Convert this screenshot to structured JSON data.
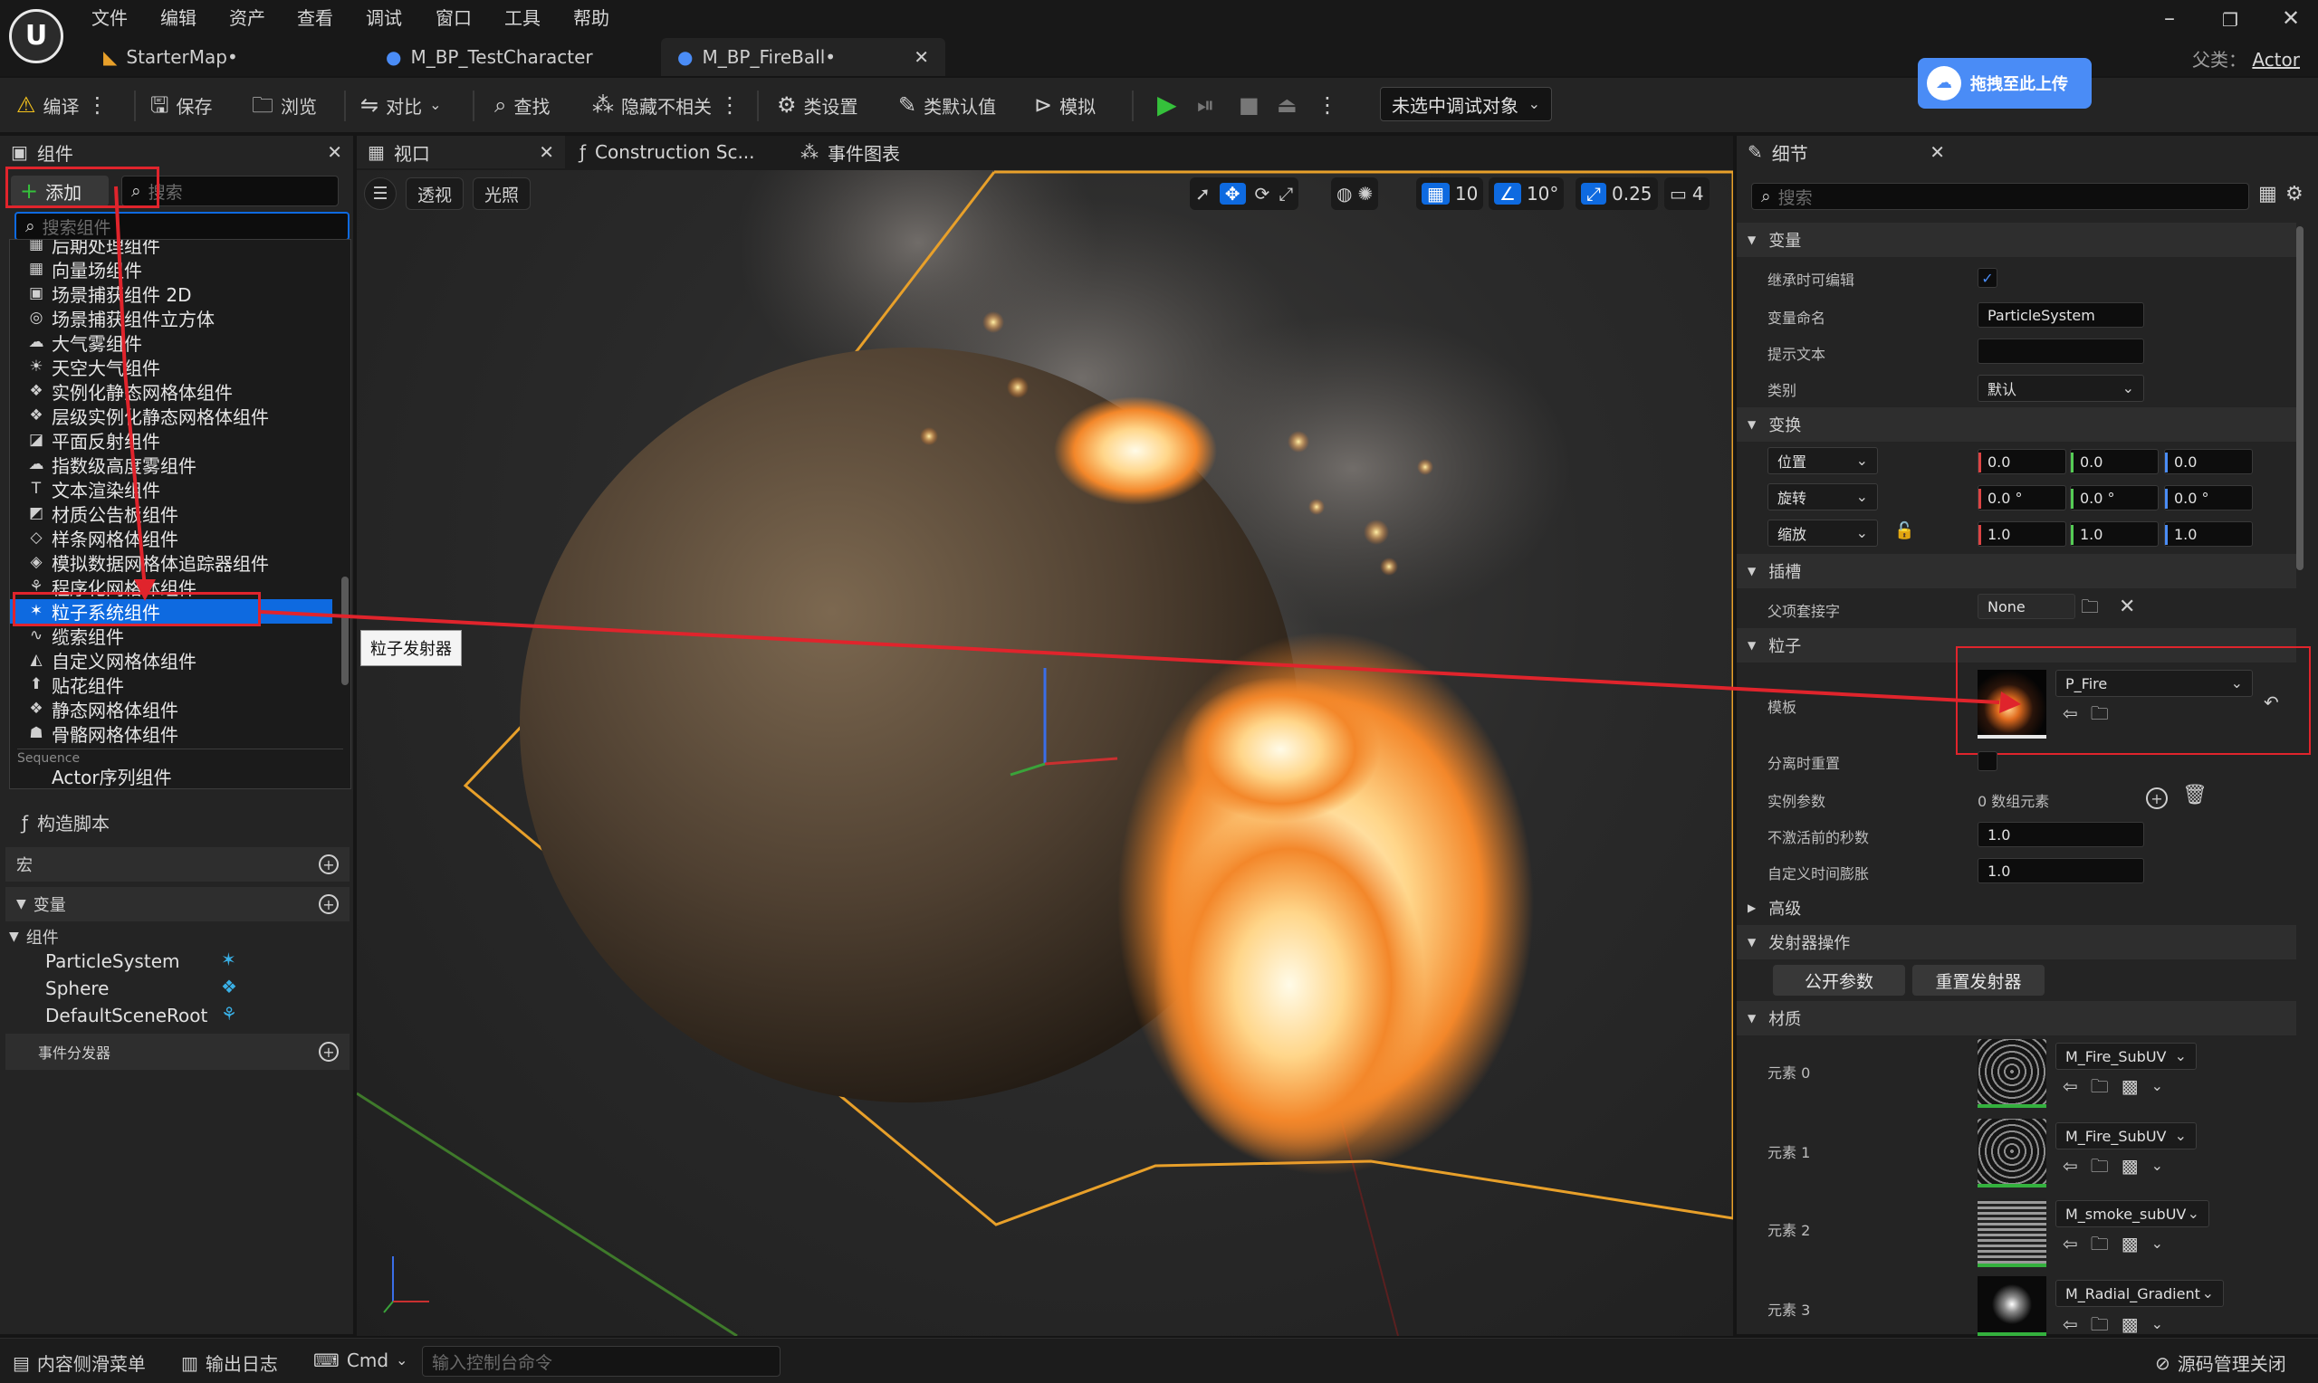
{
  "menu": [
    "文件",
    "编辑",
    "资产",
    "查看",
    "调试",
    "窗口",
    "工具",
    "帮助"
  ],
  "tabs": [
    "StarterMap•",
    "M_BP_TestCharacter",
    "M_BP_FireBall•"
  ],
  "parent": {
    "label": "父类：",
    "value": "Actor"
  },
  "toolbar": {
    "compile": "编译",
    "save": "保存",
    "browse": "浏览",
    "diff": "对比",
    "find": "查找",
    "hide_unrelated": "隐藏不相关",
    "class_settings": "类设置",
    "class_defaults": "类默认值",
    "simulate": "模拟",
    "debug_target": "未选中调试对象"
  },
  "upload": "拖拽至此上传",
  "components_panel": {
    "title": "组件",
    "add": "添加",
    "search_placeholder": "搜索",
    "dropdown_placeholder": "搜索组件",
    "items": [
      "后期处理组件",
      "向量场组件",
      "场景捕获组件 2D",
      "场景捕获组件立方体",
      "大气雾组件",
      "天空大气组件",
      "实例化静态网格体组件",
      "层级实例化静态网格体组件",
      "平面反射组件",
      "指数级高度雾组件",
      "文本渲染组件",
      "材质公告板组件",
      "样条网格体组件",
      "模拟数据网格体追踪器组件",
      "程序化网格体组件",
      "粒子系统组件",
      "缆索组件",
      "自定义网格体组件",
      "贴花组件",
      "静态网格体组件",
      "骨骼网格体组件"
    ],
    "selected_item": "粒子系统组件",
    "sequence_header": "Sequence",
    "sequence_item": "Actor序列组件",
    "construct": "构造脚本",
    "macros": "宏",
    "variables": "变量",
    "components": "组件",
    "tree": [
      "ParticleSystem",
      "Sphere",
      "DefaultSceneRoot"
    ],
    "dispatchers": "事件分发器"
  },
  "center_tabs": [
    "视口",
    "Construction Sc...",
    "事件图表"
  ],
  "viewport": {
    "perspective": "透视",
    "lit": "光照",
    "grid": "10",
    "angle": "10°",
    "scale": "0.25",
    "camera": "4"
  },
  "tooltip": "粒子发射器",
  "details": {
    "title": "细节",
    "search_placeholder": "搜索",
    "sections": {
      "variable": "变量",
      "transform": "变换",
      "sockets": "插槽",
      "particles": "粒子",
      "advanced": "高级",
      "emitter_actions": "发射器操作",
      "materials": "材质"
    },
    "rows": {
      "editable": "继承时可编辑",
      "var_name": "变量命名",
      "tooltip": "提示文本",
      "category": "类别",
      "location": "位置",
      "rotation": "旋转",
      "scale": "缩放",
      "parent_socket": "父项套接字",
      "template": "模板",
      "reset_on_detach": "分离时重置",
      "instance_params": "实例参数",
      "seconds_before_inactive": "不激活前的秒数",
      "custom_time_dilation": "自定义时间膨胀"
    },
    "values": {
      "var_name": "ParticleSystem",
      "tooltip": "",
      "category": "默认",
      "location": [
        "0.0",
        "0.0",
        "0.0"
      ],
      "rotation": [
        "0.0 °",
        "0.0 °",
        "0.0 °"
      ],
      "scale": [
        "1.0",
        "1.0",
        "1.0"
      ],
      "parent_socket": "None",
      "template": "P_Fire",
      "instance_params": "0 数组元素",
      "seconds_before_inactive": "1.0",
      "custom_time_dilation": "1.0"
    },
    "buttons": {
      "expose": "公开参数",
      "reset_emitter": "重置发射器"
    },
    "materials": [
      {
        "label": "元素 0",
        "name": "M_Fire_SubUV"
      },
      {
        "label": "元素 1",
        "name": "M_Fire_SubUV"
      },
      {
        "label": "元素 2",
        "name": "M_smoke_subUV"
      },
      {
        "label": "元素 3",
        "name": "M_Radial_Gradient"
      }
    ]
  },
  "statusbar": {
    "content_drawer": "内容侧滑菜单",
    "output_log": "输出日志",
    "cmd": "Cmd",
    "console_placeholder": "输入控制台命令",
    "source_control": "源码管理关闭"
  },
  "colors": {
    "accent": "#0e6ae0",
    "highlight_box": "#e0242c",
    "bounds": "#e8a02a"
  }
}
